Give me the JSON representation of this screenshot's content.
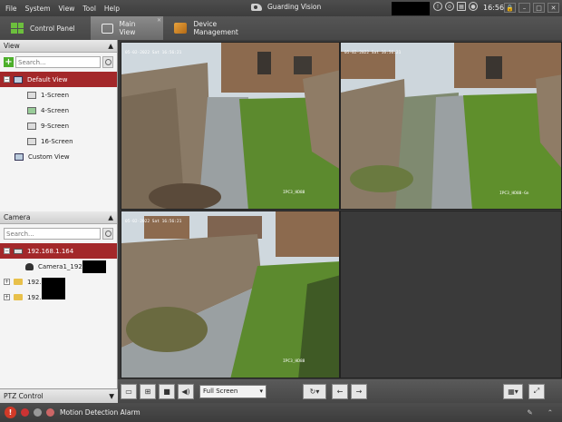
{
  "menu": [
    "File",
    "System",
    "View",
    "Tool",
    "Help"
  ],
  "app_title": "Guarding Vision",
  "clock": "16:56:22",
  "tabs": {
    "control_panel": "Control Panel",
    "main_view": "Main View",
    "device_management": "Device Management"
  },
  "view_panel": {
    "header": "View",
    "search_placeholder": "Search...",
    "default_view": "Default View",
    "screens": [
      "1-Screen",
      "4-Screen",
      "9-Screen",
      "16-Screen"
    ],
    "custom_view": "Custom View"
  },
  "camera_panel": {
    "header": "Camera",
    "search_placeholder": "Search...",
    "device1": "192.168.1.164",
    "camera1": "Camera1_192",
    "device2": "192.",
    "device3": "192."
  },
  "video": {
    "timestamp": "05-02-2022 Sat 16:56:21",
    "cam_labels": [
      "IPC3_HD88",
      "IPC3_HD88-Gn",
      "IPC3_HD88"
    ]
  },
  "toolbar": {
    "screen_select": "Full Screen"
  },
  "ptz": {
    "header": "PTZ Control"
  },
  "status": {
    "alarm": "Motion Detection Alarm"
  },
  "colors": {
    "accent": "#a3282a",
    "titlebar": "#454545",
    "alert": "#d13a28"
  }
}
